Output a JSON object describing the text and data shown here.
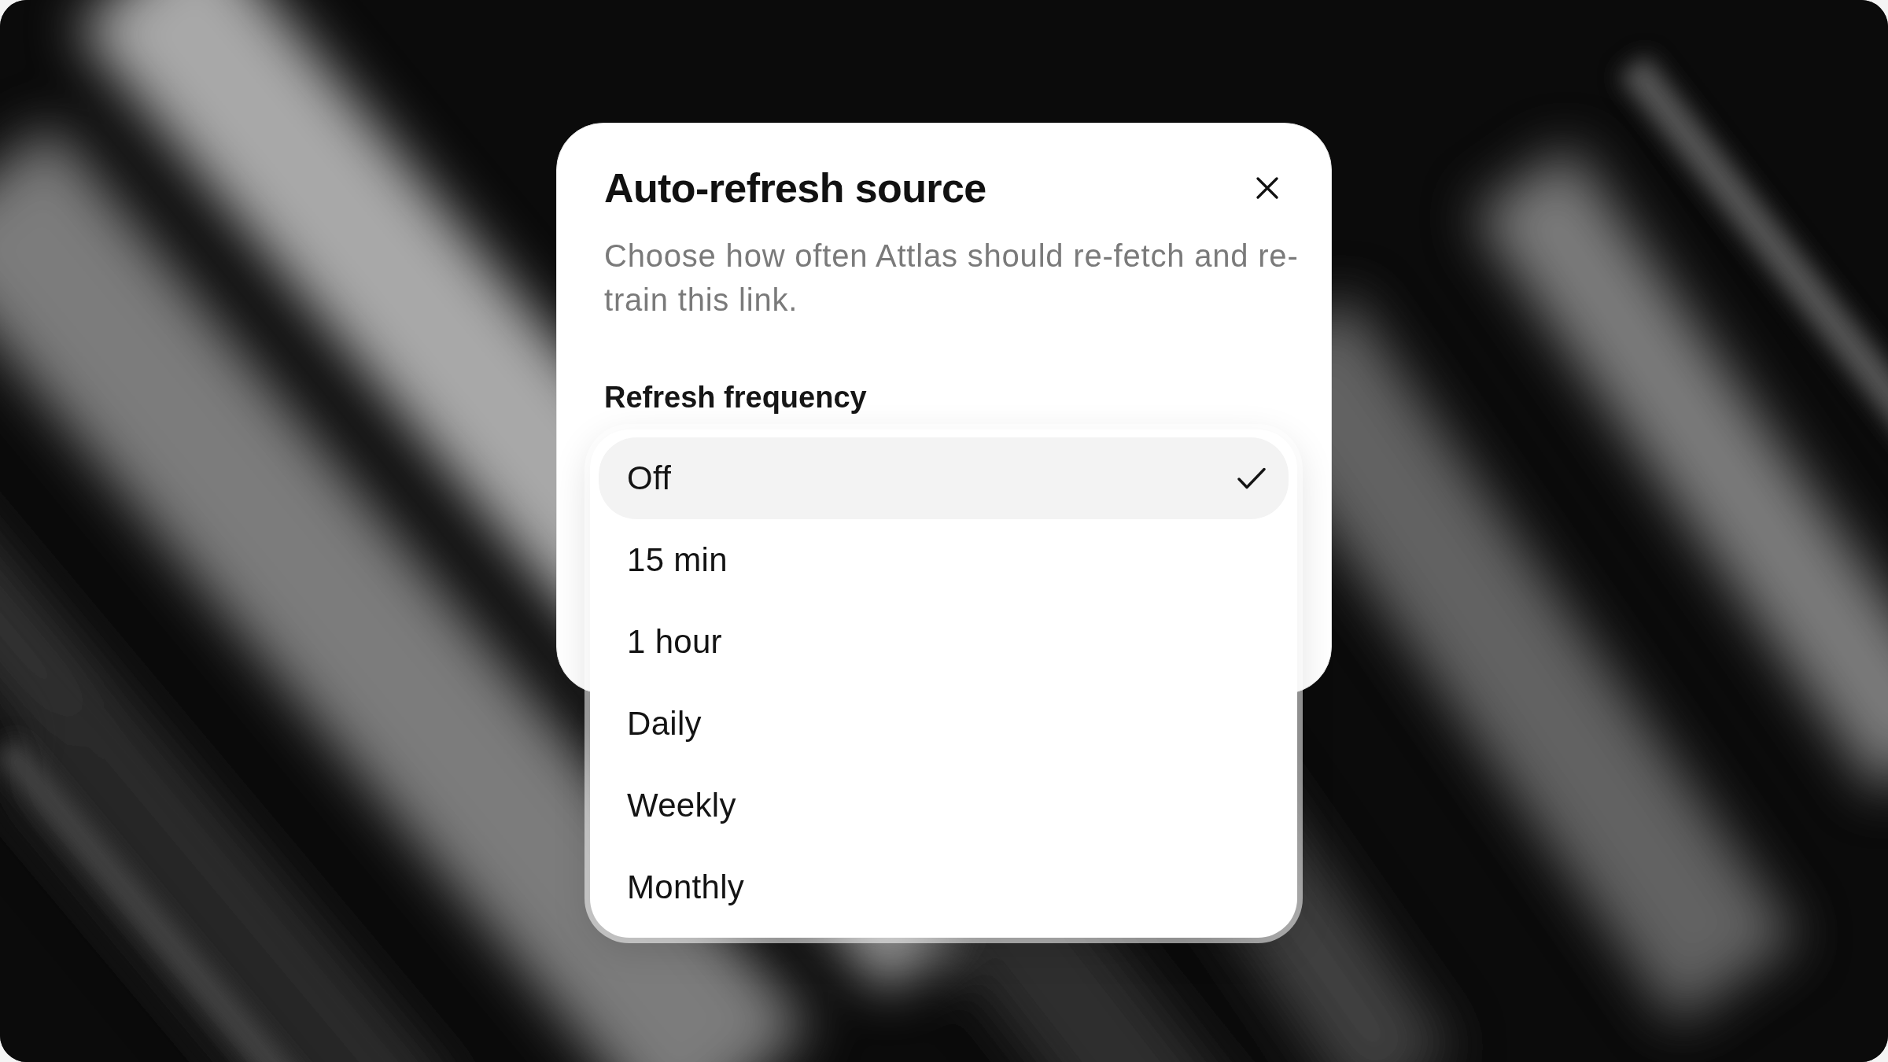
{
  "dialog": {
    "title": "Auto-refresh source",
    "description": "Choose how often Attlas should re-fetch and re-train this link.",
    "field": {
      "label": "Refresh frequency"
    },
    "menu": {
      "options": [
        {
          "label": "Off",
          "selected": true
        },
        {
          "label": "15 min",
          "selected": false
        },
        {
          "label": "1 hour",
          "selected": false
        },
        {
          "label": "Daily",
          "selected": false
        },
        {
          "label": "Weekly",
          "selected": false
        },
        {
          "label": "Monthly",
          "selected": false
        }
      ]
    }
  }
}
